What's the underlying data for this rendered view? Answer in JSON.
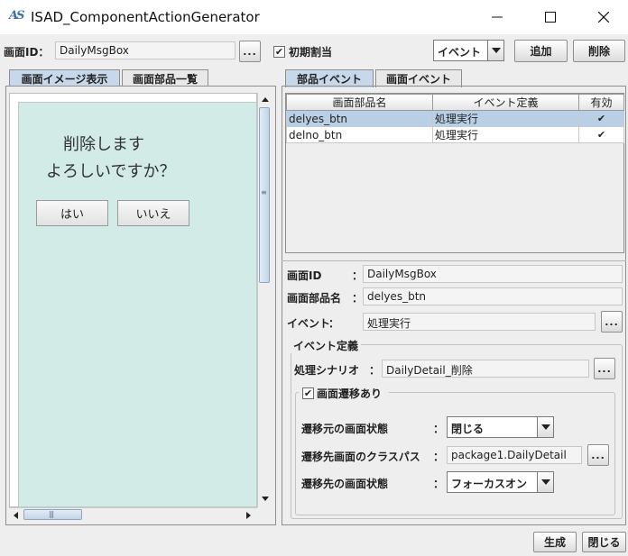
{
  "window": {
    "title": "ISAD_ComponentActionGenerator",
    "icon": "app-logo-icon"
  },
  "toolbar": {
    "screen_id_label": "画面ID：",
    "screen_id_value": "DailyMsgBox",
    "browse_label": "...",
    "initial_assign_label": "初期割当",
    "initial_assign_checked": true,
    "type_select_value": "イベント",
    "add_label": "追加",
    "delete_label": "削除"
  },
  "left_tabs": [
    {
      "label": "画面イメージ表示",
      "selected": true
    },
    {
      "label": "画面部品一覧",
      "selected": false
    }
  ],
  "preview": {
    "message_line1": "削除します",
    "message_line2": "よろしいですか？",
    "yes_label": "はい",
    "no_label": "いいえ",
    "background": "#d2ebe7"
  },
  "right_tabs": [
    {
      "label": "部品イベント",
      "selected": true
    },
    {
      "label": "画面イベント",
      "selected": false
    }
  ],
  "events_table": {
    "columns": [
      "画面部品名",
      "イベント定義",
      "有効"
    ],
    "rows": [
      {
        "component": "delyes_btn",
        "event": "処理実行",
        "enabled": "✔",
        "selected": true
      },
      {
        "component": "delno_btn",
        "event": "処理実行",
        "enabled": "✔",
        "selected": false
      }
    ]
  },
  "detail": {
    "screen_id_label": "画面ID",
    "screen_id_value": "DailyMsgBox",
    "component_label": "画面部品名",
    "component_value": "delyes_btn",
    "event_label": "イベント",
    "event_value": "処理実行",
    "colon": "：",
    "browse_label": "...",
    "event_def_group_title": "イベント定義",
    "scenario_label": "処理シナリオ",
    "scenario_value": "DailyDetail_削除",
    "navigation_label": "画面遷移あり",
    "navigation_checked": true,
    "from_state_label": "遷移元の画面状態",
    "from_state_value": "閉じる",
    "class_path_label": "遷移先画面のクラスパス",
    "class_path_value": "package1.DailyDetail",
    "to_state_label": "遷移先の画面状態",
    "to_state_value": "フォーカスオン"
  },
  "footer": {
    "generate_label": "生成",
    "close_label": "閉じる"
  },
  "colors": {
    "tab_selected": "#c6d8ea",
    "row_selected": "#b8cfe5"
  }
}
